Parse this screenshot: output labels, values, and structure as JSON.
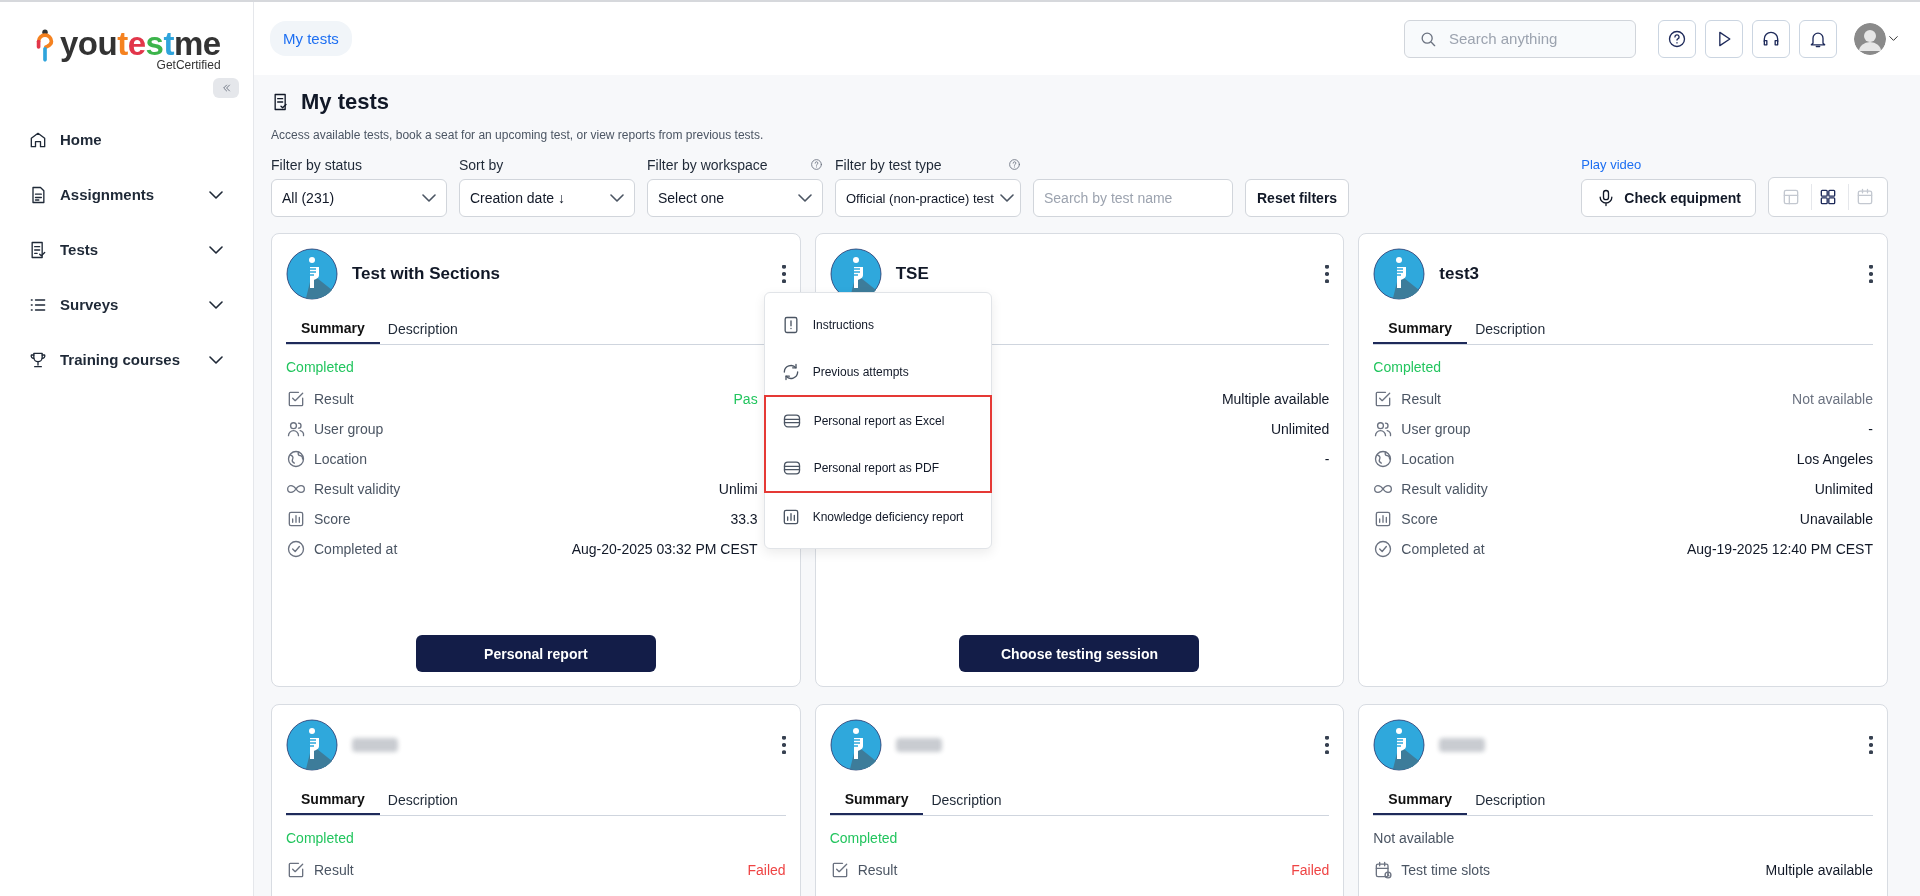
{
  "logo": {
    "name": "youtestme",
    "tagline": "GetCertified"
  },
  "sidebar": {
    "items": [
      {
        "label": "Home",
        "kind": "home",
        "expandable": false
      },
      {
        "label": "Assignments",
        "kind": "assignments",
        "expandable": true
      },
      {
        "label": "Tests",
        "kind": "tests",
        "expandable": true
      },
      {
        "label": "Surveys",
        "kind": "surveys",
        "expandable": true
      },
      {
        "label": "Training courses",
        "kind": "training",
        "expandable": true
      }
    ]
  },
  "breadcrumb": "My tests",
  "search": {
    "placeholder": "Search anything"
  },
  "header_buttons": [
    {
      "kind": "help"
    },
    {
      "kind": "play"
    },
    {
      "kind": "support"
    },
    {
      "kind": "notifications"
    }
  ],
  "page": {
    "title": "My tests",
    "subtitle": "Access available tests, book a seat for an upcoming test, or view reports from previous tests."
  },
  "filters": [
    {
      "label": "Filter by status",
      "value": "All (231)",
      "help": false
    },
    {
      "label": "Sort by",
      "value": "Creation date ↓",
      "help": false
    },
    {
      "label": "Filter by workspace",
      "value": "Select one",
      "help": true
    },
    {
      "label": "Filter by test type",
      "value": "Official (non-practice) test",
      "help": true
    }
  ],
  "test_search": {
    "placeholder": "Search by test name"
  },
  "reset_button": "Reset filters",
  "play_video": "Play video",
  "check_equipment": "Check equipment",
  "view_modes": [
    {
      "kind": "table",
      "selected": false
    },
    {
      "kind": "grid",
      "selected": true
    },
    {
      "kind": "calendar",
      "selected": false
    }
  ],
  "cards": [
    {
      "title": "Test with Sections",
      "tabs": [
        {
          "label": "Summary",
          "selected": true
        },
        {
          "label": "Description",
          "selected": false
        }
      ],
      "status": {
        "text": "Completed",
        "color": "#22c55e"
      },
      "rows": [
        {
          "kind": "result",
          "label": "Result",
          "value": "Pas",
          "color": "#22c55e"
        },
        {
          "kind": "group",
          "label": "User group"
        },
        {
          "kind": "location",
          "label": "Location"
        },
        {
          "kind": "validity",
          "label": "Result validity",
          "value": "Unlimi"
        },
        {
          "kind": "score",
          "label": "Score",
          "value": "33.3"
        },
        {
          "kind": "completed",
          "label": "Completed at",
          "value": "Aug-20-2025 03:32 PM CEST"
        }
      ],
      "button": "Personal report",
      "menu": {
        "items": [
          {
            "label": "Instructions",
            "kind": "instructions",
            "highlighted": false
          },
          {
            "label": "Previous attempts",
            "kind": "attempts",
            "highlighted": false
          },
          {
            "label": "Personal report as Excel",
            "kind": "excel",
            "highlighted": true
          },
          {
            "label": "Personal report as PDF",
            "kind": "pdf",
            "highlighted": true
          },
          {
            "label": "Knowledge deficiency report",
            "kind": "chart",
            "highlighted": false
          }
        ]
      }
    },
    {
      "title": "TSE",
      "rows": [
        {
          "value": "Multiple available"
        },
        {
          "value": "Unlimited"
        },
        {
          "value": "-"
        }
      ],
      "button": "Choose testing session"
    },
    {
      "title": "test3",
      "tabs": [
        {
          "label": "Summary",
          "selected": true
        },
        {
          "label": "Description",
          "selected": false
        }
      ],
      "status": {
        "text": "Completed",
        "color": "#22c55e"
      },
      "rows": [
        {
          "kind": "result",
          "label": "Result",
          "value": "Not available",
          "color": "#6b7280"
        },
        {
          "kind": "group",
          "label": "User group",
          "value": "-"
        },
        {
          "kind": "location",
          "label": "Location",
          "value": "Los Angeles"
        },
        {
          "kind": "validity",
          "label": "Result validity",
          "value": "Unlimited"
        },
        {
          "kind": "score",
          "label": "Score",
          "value": "Unavailable"
        },
        {
          "kind": "completed",
          "label": "Completed at",
          "value": "Aug-19-2025 12:40 PM CEST"
        }
      ]
    },
    {
      "tabs": [
        {
          "label": "Summary",
          "selected": true
        },
        {
          "label": "Description",
          "selected": false
        }
      ],
      "status": {
        "text": "Completed",
        "color": "#22c55e"
      },
      "rows": [
        {
          "kind": "result",
          "label": "Result",
          "value": "Failed",
          "color": "#ef4444"
        }
      ]
    },
    {
      "tabs": [
        {
          "label": "Summary",
          "selected": true
        },
        {
          "label": "Description",
          "selected": false
        }
      ],
      "status": {
        "text": "Completed",
        "color": "#22c55e"
      },
      "rows": [
        {
          "kind": "result",
          "label": "Result",
          "value": "Failed",
          "color": "#ef4444"
        }
      ]
    },
    {
      "tabs": [
        {
          "label": "Summary",
          "selected": true
        },
        {
          "label": "Description",
          "selected": false
        }
      ],
      "status": {
        "text": "Not available",
        "color": "#4b5563"
      },
      "rows": [
        {
          "kind": "slots",
          "label": "Test time slots",
          "value": "Multiple available"
        }
      ]
    }
  ]
}
